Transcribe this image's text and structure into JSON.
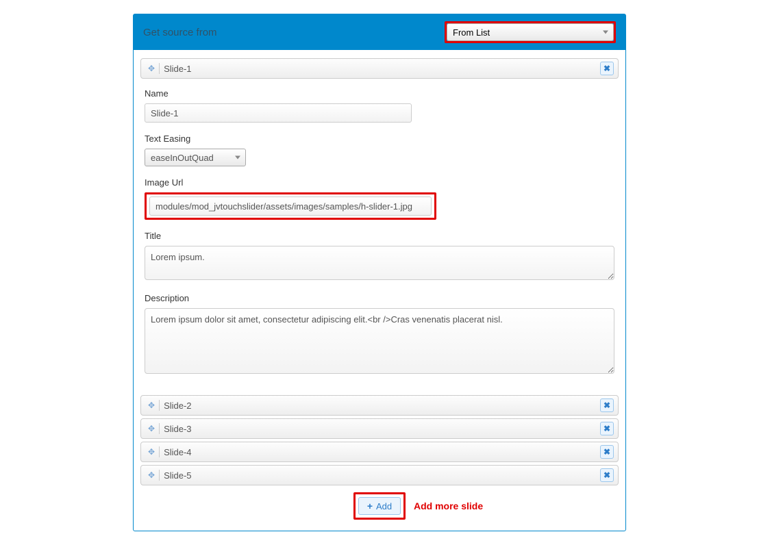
{
  "header": {
    "title": "Get source from",
    "source_select": "From List"
  },
  "expanded_slide": {
    "bar_name": "Slide-1",
    "name_label": "Name",
    "name_value": "Slide-1",
    "easing_label": "Text Easing",
    "easing_value": "easeInOutQuad",
    "image_label": "Image Url",
    "image_value": "modules/mod_jvtouchslider/assets/images/samples/h-slider-1.jpg",
    "title_label": "Title",
    "title_value": "Lorem ipsum.",
    "desc_label": "Description",
    "desc_value": "Lorem ipsum dolor sit amet, consectetur adipiscing elit.<br />Cras venenatis placerat nisl."
  },
  "collapsed_slides": [
    {
      "name": "Slide-2"
    },
    {
      "name": "Slide-3"
    },
    {
      "name": "Slide-4"
    },
    {
      "name": "Slide-5"
    }
  ],
  "add_button_label": "Add",
  "annotation_text": "Add more slide"
}
